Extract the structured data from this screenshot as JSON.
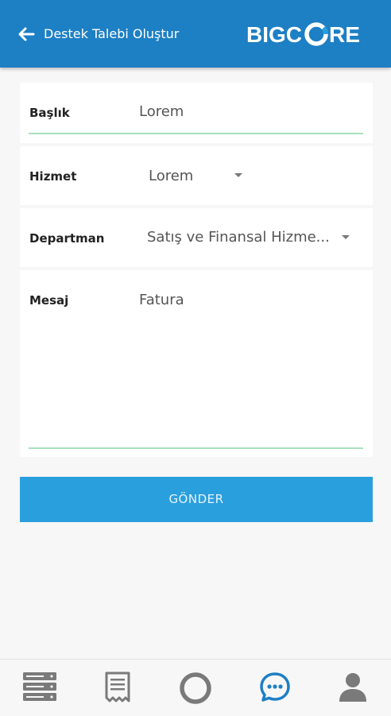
{
  "header": {
    "title": "Destek Talebi Oluştur",
    "back_icon": "arrow-left-icon",
    "logo_text_1": "BIGC",
    "logo_text_2": "RE"
  },
  "form": {
    "baslik": {
      "label": "Başlık",
      "value": "Lorem"
    },
    "hizmet": {
      "label": "Hizmet",
      "value": "Lorem"
    },
    "departman": {
      "label": "Departman",
      "value": "Satış ve Finansal Hizme..."
    },
    "mesaj": {
      "label": "Mesaj",
      "value": "Fatura"
    }
  },
  "submit_label": "GÖNDER",
  "nav": {
    "items": [
      {
        "icon": "server-list-icon",
        "active": false
      },
      {
        "icon": "receipt-icon",
        "active": false
      },
      {
        "icon": "circle-home-icon",
        "active": false
      },
      {
        "icon": "chat-bubble-icon",
        "active": true
      },
      {
        "icon": "user-icon",
        "active": false
      }
    ]
  },
  "colors": {
    "header_bg": "#1d7fc4",
    "button_bg": "#2a9fde",
    "underline": "#a9e0bc",
    "nav_icon": "#7a7a7a",
    "nav_active": "#1d7fc4"
  }
}
